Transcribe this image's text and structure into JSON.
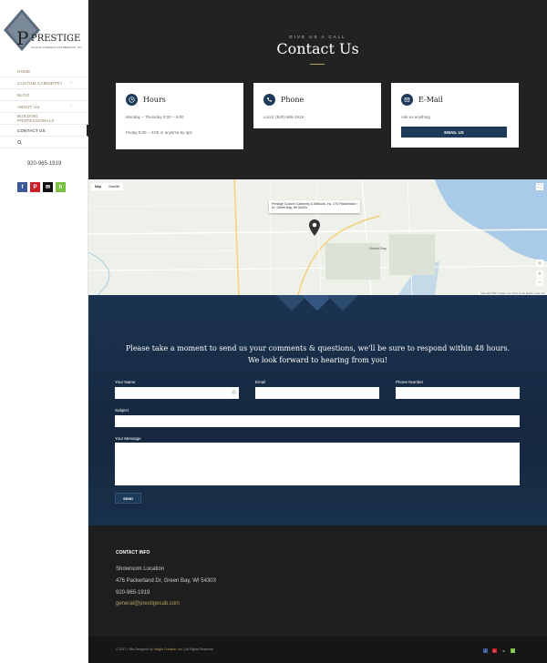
{
  "brand": {
    "name": "PRESTIGE",
    "tagline": "Custom Cabinetry and Millwork, Inc."
  },
  "nav": [
    {
      "label": "HOME",
      "has_sub": false
    },
    {
      "label": "CUSTOM CABINETRY",
      "has_sub": true
    },
    {
      "label": "BLOG",
      "has_sub": false
    },
    {
      "label": "ABOUT US",
      "has_sub": true
    },
    {
      "label": "BUILDING PROFESSIONALS",
      "has_sub": false
    },
    {
      "label": "CONTACT US",
      "has_sub": false
    }
  ],
  "sidebar": {
    "phone": "920-965-1919"
  },
  "icons": {
    "search": "search-icon",
    "facebook": "facebook-icon",
    "pinterest": "pinterest-icon",
    "email": "email-icon",
    "houzz": "houzz-icon",
    "phone": "phone-icon",
    "clock": "clock-icon",
    "pin": "map-pin-icon"
  },
  "colors": {
    "navy": "#1d3a5a",
    "gold": "#b8a060",
    "dark": "#222222"
  },
  "hero": {
    "subtitle": "GIVE US A CALL",
    "title": "Contact Us"
  },
  "cards": {
    "hours": {
      "title": "Hours",
      "line1": "Monday – Thursday 8:00 – 5:00",
      "line2": "Friday 8:00 – 4:00 or anytime by apt."
    },
    "phone": {
      "title": "Phone",
      "line1": "Local: (920) 965-1919"
    },
    "email": {
      "title": "E-Mail",
      "line1": "Ask us anything",
      "button": "EMAIL US"
    }
  },
  "map": {
    "tab_map": "Map",
    "tab_satellite": "Satellite",
    "info": "Prestige Custom Cabinetry & Millwork, Inc, 476 Packerland Dr, Green Bay, WI 54303",
    "label_greenbay": "Green Bay",
    "footer": "Map data ©2017 Google  1 km  Terms of Use  Report a map error"
  },
  "form": {
    "intro": "Please take a moment to send us your comments & questions, we'll be sure to respond within 48 hours. We look forward to hearing from you!",
    "name_label": "Your Name",
    "email_label": "Email",
    "phone_label": "Phone Number",
    "subject_label": "Subject",
    "message_label": "Your Message",
    "send": "SEND"
  },
  "contact_info": {
    "heading": "CONTACT INFO",
    "showroom": "Showroom Location",
    "address": "476 Packerland Dr, Green Bay, WI 54303",
    "phone": "920-965-1919",
    "email": "general@prestigecab.com"
  },
  "footer": {
    "copyright": "© 2017",
    "designed_by": "Site Designed by",
    "designer": "Insight Creative, Inc.",
    "rights": "All Rights Reserved"
  }
}
